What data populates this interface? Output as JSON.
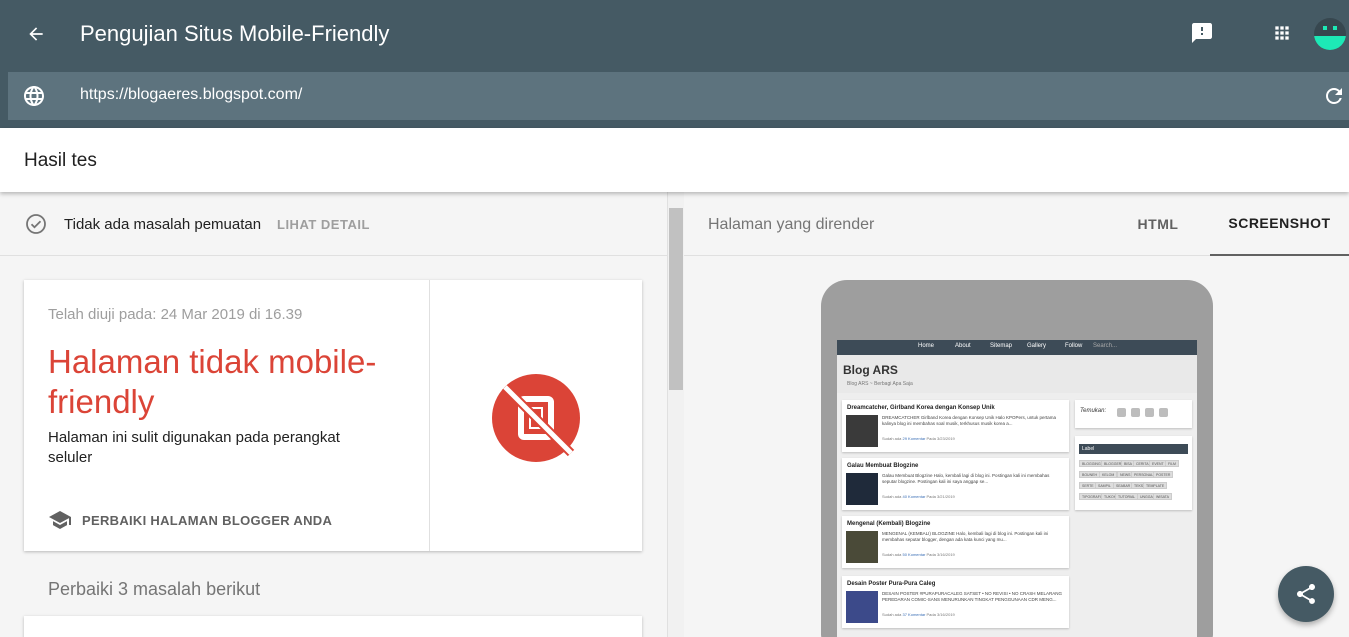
{
  "header": {
    "title": "Pengujian Situs Mobile-Friendly",
    "back_icon": "arrow-back-icon",
    "feedback_icon": "feedback-icon",
    "apps_icon": "apps-grid-icon",
    "avatar_icon": "avatar-icon"
  },
  "url_bar": {
    "url": "https://blogaeres.blogspot.com/",
    "globe_icon": "globe-icon",
    "refresh_icon": "refresh-icon"
  },
  "results": {
    "title": "Hasil tes"
  },
  "status": {
    "text": "Tidak ada masalah pemuatan",
    "detail_link": "LIHAT DETAIL"
  },
  "result_card": {
    "tested_on": "Telah diuji pada: 24 Mar 2019 di 16.39",
    "verdict": "Halaman tidak mobile-friendly",
    "description": "Halaman ini sulit digunakan pada perangkat seluler",
    "fix_link": "PERBAIKI HALAMAN BLOGGER ANDA",
    "verdict_icon": "not-mobile-friendly-icon"
  },
  "issues": {
    "heading": "Perbaiki 3 masalah berikut"
  },
  "right_panel": {
    "label": "Halaman yang dirender",
    "tabs": [
      {
        "label": "HTML",
        "active": false
      },
      {
        "label": "SCREENSHOT",
        "active": true
      }
    ]
  },
  "preview": {
    "nav": [
      "Home",
      "About",
      "Sitemap",
      "Gallery",
      "Follow",
      "Search..."
    ],
    "blog_title": "Blog ARS",
    "blog_subtitle": "Blog ARS ~ Berbagi Apa Saja",
    "posts": [
      {
        "title": "Dreamcatcher, Girlband Korea dengan Konsep Unik",
        "body": "DREAMCATCHER Girlband Korea dengan Konsep Unik Halo KPOPers, untuk pertama kalinya blog ini membahas soal musik, terkhusus musik korea a...",
        "meta_prefix": "Sudah ada",
        "meta_link": "29 Komentar",
        "meta_suffix": "Pada 3/23/2019"
      },
      {
        "title": "Galau Membuat Blogzine",
        "body": "Galau Membuat Blogzine Halo, kembali lagi di blog ini. Postingan kali ini membahas seputar blogzine. Postingan kali ini saya anggap se...",
        "meta_prefix": "Sudah ada",
        "meta_link": "40 Komentar",
        "meta_suffix": "Pada 3/21/2019"
      },
      {
        "title": "Mengenal (Kembali) Blogzine",
        "body": "MENGENAL (KEMBALI) BLOGZINE Halo, kembali lagi di blog ini. Postingan kali ini membahas seputar blogger, dengan ada kata kunci yang mu...",
        "meta_prefix": "Sudah ada",
        "meta_link": "50 Komentar",
        "meta_suffix": "Pada 3/16/2019"
      },
      {
        "title": "Desain Poster Pura-Pura Caleg",
        "body": "DESAIN POSTER #PURAPURACALEG SATSET • NO REVISI • NO CRASH MELARANG PEREDARAN COMIC-SANS MENURUNKAN TINGKAT PENGGUNAAN CDR MENG...",
        "meta_prefix": "Sudah ada",
        "meta_link": "37 Komentar",
        "meta_suffix": "Pada 3/16/2019"
      }
    ],
    "side_find_label": "Temukan:",
    "side_label_title": "Label",
    "tags": [
      "BLOGGING",
      "BLOGGER",
      "BISA",
      "CERITA",
      "EVENT",
      "FILM",
      "BOUNEH",
      "KELOM",
      "NEWS",
      "PERSONAL",
      "POSTER",
      "SERTE",
      "SAMPIL",
      "SEABAR",
      "TEKS",
      "TEMPLATE",
      "TIPOGRAFI",
      "TUKOH",
      "TUTORIAL",
      "UNGGA",
      "WISATA"
    ]
  },
  "fab": {
    "share_icon": "share-icon"
  },
  "colors": {
    "appbar": "#455a64",
    "urlbar": "#5d737e",
    "error_red": "#db4437"
  }
}
